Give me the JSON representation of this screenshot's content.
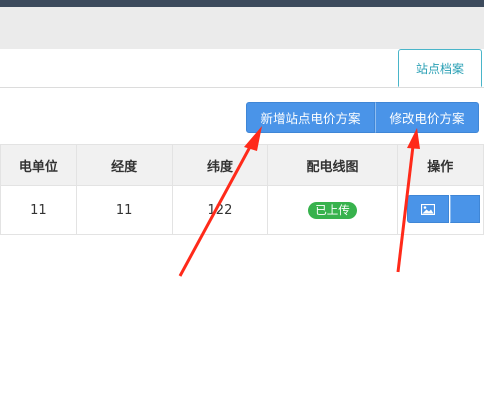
{
  "tabs": [
    {
      "label": "站点档案",
      "active": true
    }
  ],
  "toolbar": {
    "add_label": "新增站点电价方案",
    "edit_label": "修改电价方案"
  },
  "table": {
    "columns": [
      "电单位",
      "经度",
      "纬度",
      "配电线图",
      "操作"
    ],
    "rows": [
      {
        "unit": "11",
        "longitude": "11",
        "latitude": "122",
        "diagram_status": "已上传"
      }
    ]
  },
  "icons": {
    "row_image_button": "image-icon"
  },
  "colors": {
    "primary_button": "#4a94e8",
    "badge_green": "#37b24d",
    "tab_accent": "#2aa0b5",
    "annotation_arrow": "#ff2a1a",
    "header_bar": "#3c4a5c"
  }
}
